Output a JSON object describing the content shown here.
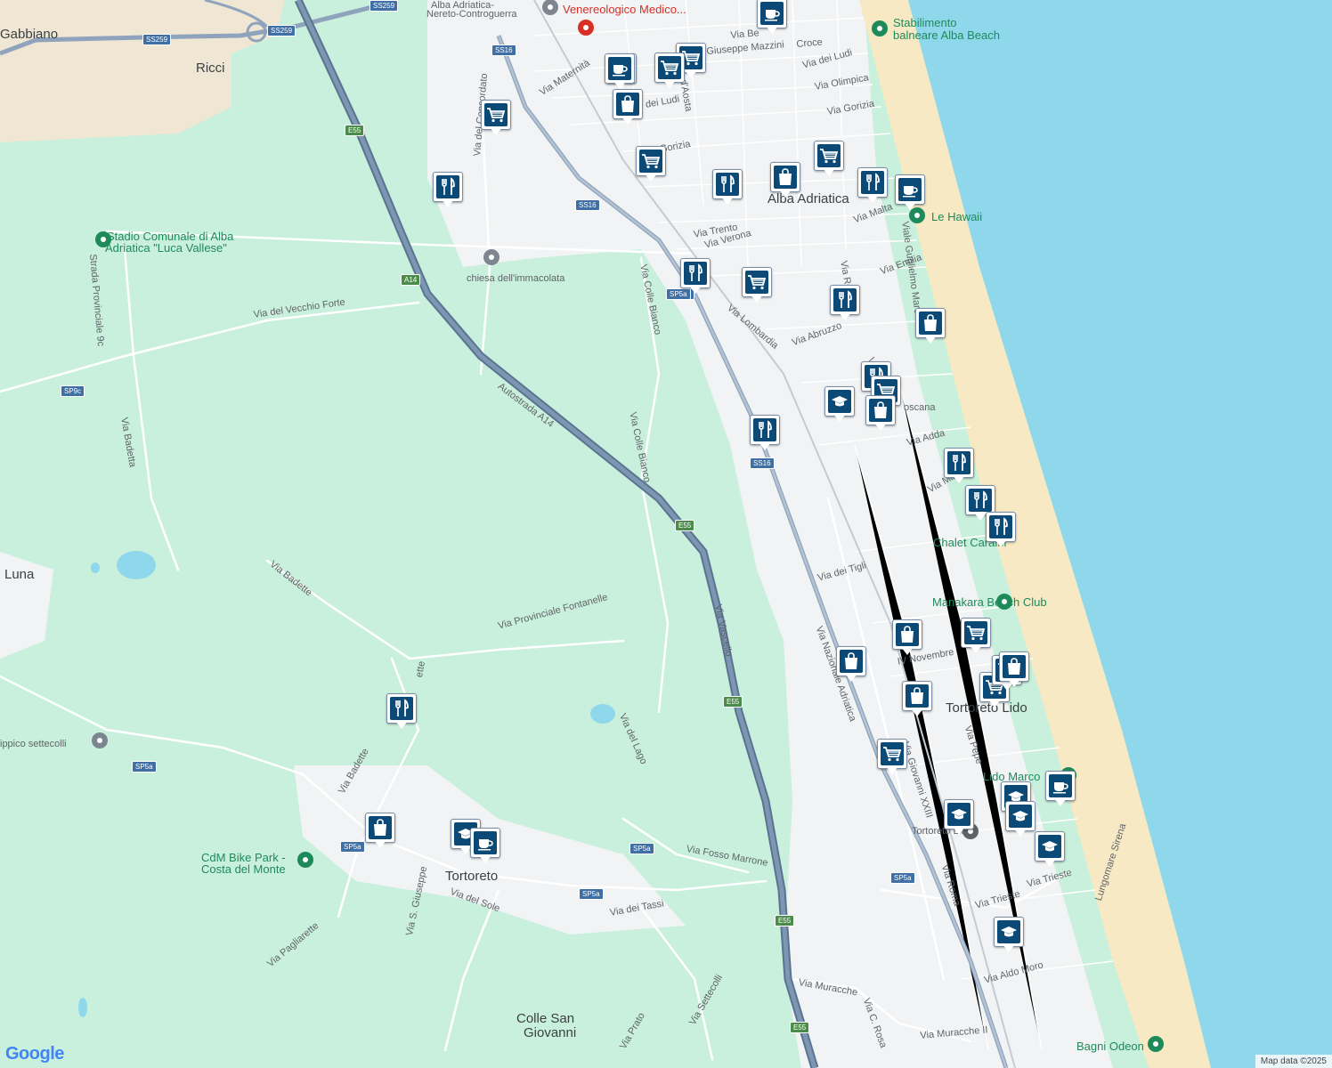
{
  "map": {
    "attribution": "Map data ©2025",
    "logo": "Google",
    "colors": {
      "land": "#c9f0dc",
      "urban": "#f1f3f4",
      "sea": "#8fd8ec",
      "beach": "#f6e9c4",
      "motorway": "#6e8aa8",
      "marker": "#0b4a76",
      "park_poi": "#1e8a5a",
      "medical_poi": "#d93025"
    }
  },
  "places": [
    {
      "text": "Gabbiano"
    },
    {
      "text": "Ricci"
    },
    {
      "text": "Alba Adriatica"
    },
    {
      "text": "Luna"
    },
    {
      "text": "Tortoreto"
    },
    {
      "text": "Tortoreto Lido"
    },
    {
      "text": "Colle San"
    },
    {
      "text": "Giovanni"
    }
  ],
  "pois": [
    {
      "text": "Stabilimento"
    },
    {
      "text": "balneare Alba Beach"
    },
    {
      "text": "Le Hawaii"
    },
    {
      "text": "Chalet Caraibi"
    },
    {
      "text": "Manakara Beach Club"
    },
    {
      "text": "Lido Marco"
    },
    {
      "text": "Bagni Odeon"
    },
    {
      "text": "Stadio Comunale di Alba"
    },
    {
      "text": "Adriatica \"Luca Vallese\""
    },
    {
      "text": "chiesa dell'immacolata"
    },
    {
      "text": "CdM Bike Park -"
    },
    {
      "text": "Costa del Monte"
    },
    {
      "text": "ippico settecolli"
    },
    {
      "text": "Tortoreto Lido"
    },
    {
      "text": "Alba Adriatica-"
    },
    {
      "text": "Nereto-Controguerra"
    },
    {
      "text": "Venereologico Medico..."
    },
    {
      "text": "Me"
    }
  ],
  "streets": [
    {
      "text": "Autostrada A14"
    },
    {
      "text": "Via Nazionale Adriatica"
    },
    {
      "text": "Via Lombardia"
    },
    {
      "text": "Via Vascello"
    },
    {
      "text": "Via Colle Bianco"
    },
    {
      "text": "Via Colle Bianco"
    },
    {
      "text": "Via Maternità"
    },
    {
      "text": "Via del Concordato"
    },
    {
      "text": "Via del Vecchio Forte"
    },
    {
      "text": "Strada Provinciale 9c"
    },
    {
      "text": "Via Badetta"
    },
    {
      "text": "Via Badette"
    },
    {
      "text": "Via Provinciale Fontanelle"
    },
    {
      "text": "Via del Lago"
    },
    {
      "text": "Via Fosso Marrone"
    },
    {
      "text": "Via dei Tassi"
    },
    {
      "text": "Via del Sole"
    },
    {
      "text": "Via Pagliarette"
    },
    {
      "text": "Via S. Giuseppe"
    },
    {
      "text": "Via Settecolli"
    },
    {
      "text": "Via Prato"
    },
    {
      "text": "Via Muracche"
    },
    {
      "text": "Via Muracche II"
    },
    {
      "text": "Via C. Rosa"
    },
    {
      "text": "Via Roma"
    },
    {
      "text": "Via Trieste"
    },
    {
      "text": "Via Trieste"
    },
    {
      "text": "Via Aldo Moro"
    },
    {
      "text": "Lungomare Sirena"
    },
    {
      "text": "Via Giovanni XXIII"
    },
    {
      "text": "Via Pepe"
    },
    {
      "text": "IV Novembre"
    },
    {
      "text": "Via dei Tigli"
    },
    {
      "text": "Via Adda"
    },
    {
      "text": "Via Min"
    },
    {
      "text": "oscana"
    },
    {
      "text": "Via Abruzzo"
    },
    {
      "text": "Via Emilia"
    },
    {
      "text": "Via Verona"
    },
    {
      "text": "Via Trento"
    },
    {
      "text": "Via Malta"
    },
    {
      "text": "Viale Guglielmo Marconi"
    },
    {
      "text": "Via Gorizia"
    },
    {
      "text": "Gorizia"
    },
    {
      "text": "Via Olimpica"
    },
    {
      "text": "Via dei Ludi"
    },
    {
      "text": "dei Ludi"
    },
    {
      "text": "Giuseppe Mazzini"
    },
    {
      "text": "Via Be"
    },
    {
      "text": "Croce"
    },
    {
      "text": "Duca d'Aosta"
    },
    {
      "text": "Via Ro"
    },
    {
      "text": "Via"
    },
    {
      "text": "Via Badette"
    },
    {
      "text": "ette"
    }
  ],
  "shields": [
    {
      "text": "SS259"
    },
    {
      "text": "SS259"
    },
    {
      "text": "SS259"
    },
    {
      "text": "SS16"
    },
    {
      "text": "SS16"
    },
    {
      "text": "SS16"
    },
    {
      "text": "SP5a"
    },
    {
      "text": "SS16"
    },
    {
      "text": "E55"
    },
    {
      "text": "A14"
    },
    {
      "text": "E55"
    },
    {
      "text": "E55"
    },
    {
      "text": "E55"
    },
    {
      "text": "E55"
    },
    {
      "text": "SP9c"
    },
    {
      "text": "SP5a"
    },
    {
      "text": "SP5a"
    },
    {
      "text": "SP5a"
    },
    {
      "text": "SP5a"
    },
    {
      "text": "SP5a"
    }
  ],
  "markers": [
    {
      "name": "cafe"
    },
    {
      "name": "school"
    },
    {
      "name": "grocery"
    },
    {
      "name": "grocery"
    },
    {
      "name": "cafe"
    },
    {
      "name": "shopping"
    },
    {
      "name": "grocery"
    },
    {
      "name": "grocery"
    },
    {
      "name": "restaurant"
    },
    {
      "name": "restaurant"
    },
    {
      "name": "shopping"
    },
    {
      "name": "grocery"
    },
    {
      "name": "restaurant"
    },
    {
      "name": "cafe"
    },
    {
      "name": "restaurant"
    },
    {
      "name": "grocery"
    },
    {
      "name": "restaurant"
    },
    {
      "name": "shopping"
    },
    {
      "name": "school"
    },
    {
      "name": "restaurant"
    },
    {
      "name": "grocery"
    },
    {
      "name": "shopping"
    },
    {
      "name": "restaurant"
    },
    {
      "name": "restaurant"
    },
    {
      "name": "restaurant"
    },
    {
      "name": "restaurant"
    },
    {
      "name": "shopping"
    },
    {
      "name": "grocery"
    },
    {
      "name": "shopping"
    },
    {
      "name": "shopping"
    },
    {
      "name": "grocery"
    },
    {
      "name": "grocery"
    },
    {
      "name": "shopping"
    },
    {
      "name": "grocery"
    },
    {
      "name": "cafe"
    },
    {
      "name": "school"
    },
    {
      "name": "school"
    },
    {
      "name": "school"
    },
    {
      "name": "school"
    },
    {
      "name": "school"
    },
    {
      "name": "restaurant"
    },
    {
      "name": "shopping"
    },
    {
      "name": "school"
    },
    {
      "name": "cafe"
    }
  ]
}
